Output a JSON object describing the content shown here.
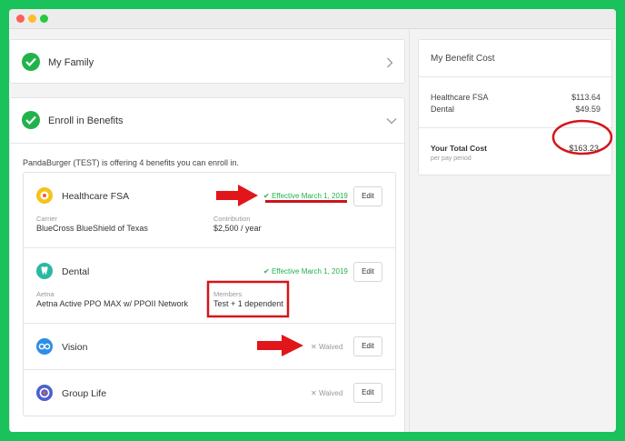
{
  "sections": {
    "family": {
      "title": "My Family"
    },
    "enroll": {
      "title": "Enroll in Benefits",
      "intro": "PandaBurger (TEST) is offering 4 benefits you can enroll in."
    }
  },
  "benefits": [
    {
      "name": "Healthcare FSA",
      "status": "Effective March 1, 2019",
      "edit": "Edit",
      "field1_label": "Carrier",
      "field1_value": "BlueCross BlueShield of Texas",
      "field2_label": "Contribution",
      "field2_value": "$2,500 / year"
    },
    {
      "name": "Dental",
      "status": "Effective March 1, 2019",
      "edit": "Edit",
      "field1_label": "Aetna",
      "field1_value": "Aetna Active PPO MAX w/ PPOII Network",
      "field2_label": "Members",
      "field2_value": "Test + 1 dependent"
    },
    {
      "name": "Vision",
      "status": "Waived",
      "edit": "Edit"
    },
    {
      "name": "Group Life",
      "status": "Waived",
      "edit": "Edit"
    }
  ],
  "cost": {
    "title": "My Benefit Cost",
    "lines": [
      {
        "label": "Healthcare FSA",
        "amount": "$113.64"
      },
      {
        "label": "Dental",
        "amount": "$49.59"
      }
    ],
    "total_label": "Your Total Cost",
    "total_sub": "per pay period",
    "total_amount": "$163.23"
  },
  "colors": {
    "accent_green": "#21b34b",
    "annotation_red": "#e0161b",
    "frame_green": "#19c25a"
  }
}
